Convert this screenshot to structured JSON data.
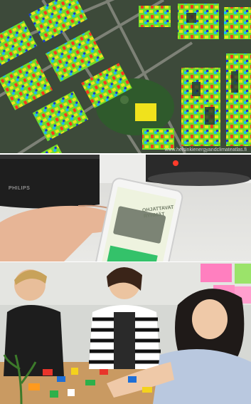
{
  "panels": {
    "city_map": {
      "credit": "www.helsinkienergyandclimateatlas.fi"
    },
    "phone_app": {
      "brand_text": "PHILIPS",
      "screen_title": "OHJATTAVAT",
      "screen_subtitle": "RYHMÄT"
    },
    "workshop": {}
  },
  "colors": {
    "roof_hot": "#ff3a1e",
    "roof_warm": "#f4e21c",
    "roof_mid": "#7ee82a",
    "roof_cool": "#1fb8ef",
    "roof_cold": "#1b2fd6",
    "app_green": "#34c26a",
    "app_bg": "#eef3df"
  }
}
